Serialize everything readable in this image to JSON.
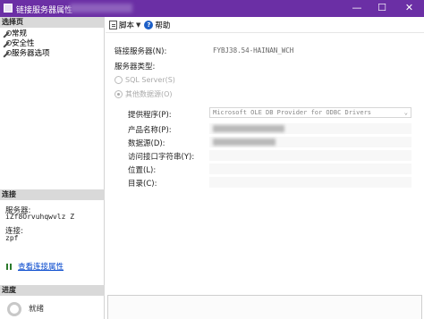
{
  "window": {
    "title": "链接服务器属性",
    "controls": {
      "minimize": "—",
      "maximize": "☐",
      "close": "✕"
    }
  },
  "left": {
    "select_page_header": "选择页",
    "pages": [
      {
        "label": "常规",
        "icon": "wrench-icon"
      },
      {
        "label": "安全性",
        "icon": "wrench-icon"
      },
      {
        "label": "服务器选项",
        "icon": "wrench-icon"
      }
    ],
    "connection_header": "连接",
    "server_label": "服务器:",
    "server_value": "iZf8Orvuhqwvlz Z",
    "connection_label": "连接:",
    "connection_value": "zpf",
    "view_connection_link": "查看连接属性",
    "progress_header": "进度",
    "progress_status": "就绪"
  },
  "toolbar": {
    "script_label": "脚本",
    "help_label": "帮助"
  },
  "form": {
    "linked_server_label": "链接服务器(N):",
    "linked_server_value": "FYBJ38.54-HAINAN_WCH",
    "server_type_label": "服务器类型:",
    "sql_server_option": "SQL Server(S)",
    "other_source_option": "其他数据源(O)",
    "provider_label": "提供程序(P):",
    "provider_value": "Microsoft OLE DB Provider for ODBC Drivers",
    "product_name_label": "产品名称(P):",
    "data_source_label": "数据源(D):",
    "provider_string_label": "访问接口字符串(Y):",
    "location_label": "位置(L):",
    "catalog_label": "目录(C):"
  }
}
